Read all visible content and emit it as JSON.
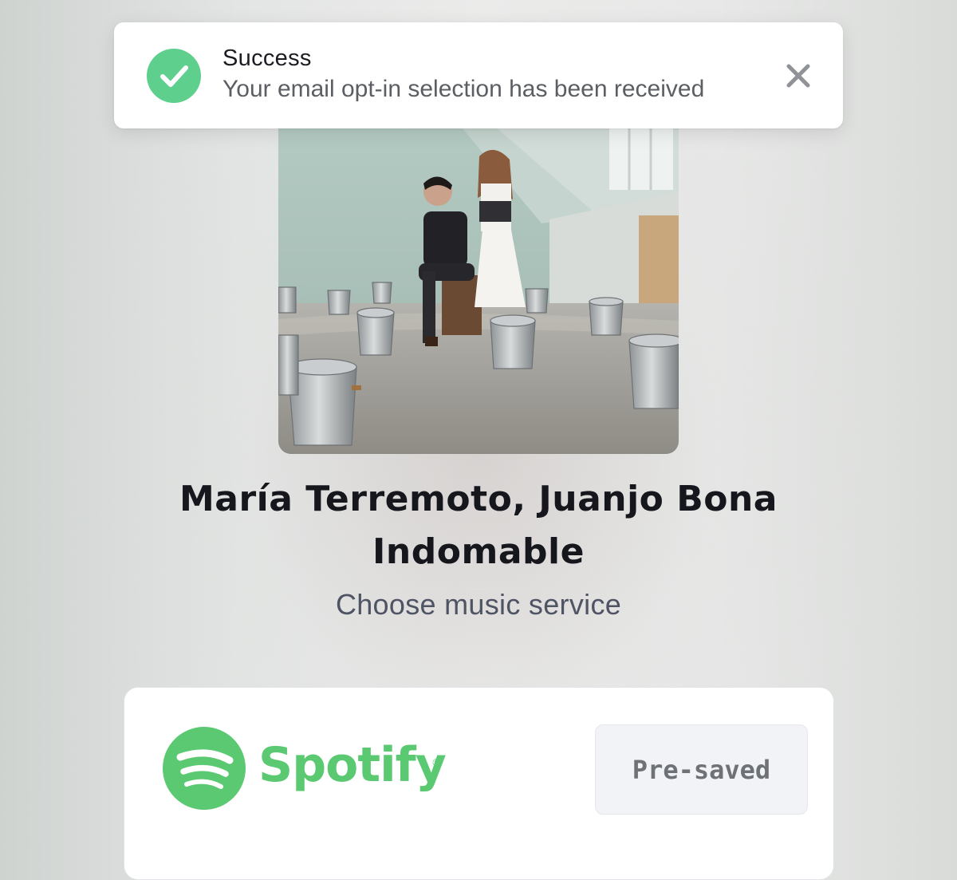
{
  "toast": {
    "title": "Success",
    "message": "Your email opt-in selection has been received",
    "icon": "check-circle-icon",
    "close_icon": "close-icon",
    "accent_color": "#5fcf8d"
  },
  "release": {
    "artists": "María Terremoto, Juanjo Bona",
    "title": "Indomable",
    "prompt": "Choose music service"
  },
  "services": [
    {
      "name": "Spotify",
      "registered_mark": "®",
      "button_label": "Pre-saved",
      "brand_color": "#5bc971"
    }
  ]
}
